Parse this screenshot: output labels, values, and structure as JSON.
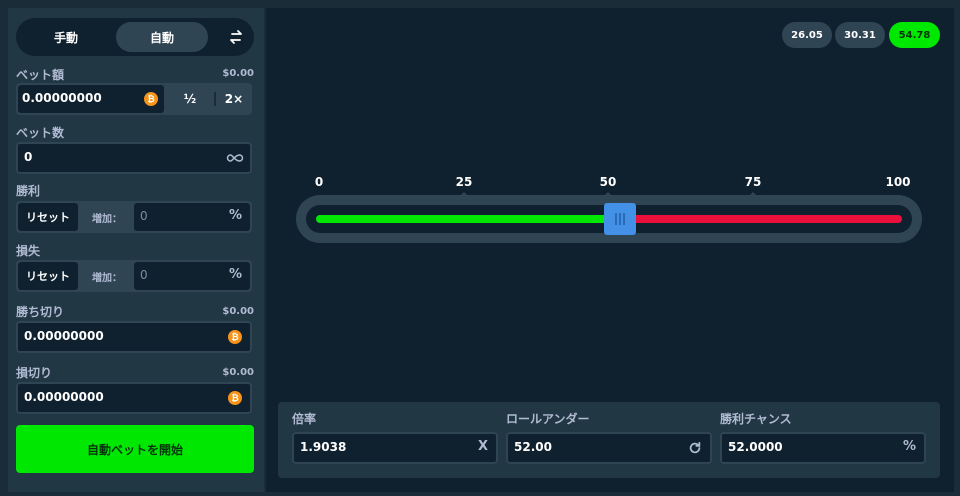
{
  "sidebar": {
    "mode_tabs": {
      "manual": "手動",
      "auto": "自動"
    },
    "bet_amount": {
      "label": "ベット額",
      "usd": "$0.00",
      "value": "0.00000000",
      "half": "½",
      "double": "2×"
    },
    "bet_count": {
      "label": "ベット数",
      "value": "0"
    },
    "on_win": {
      "label": "勝利",
      "reset": "リセット",
      "increase": "増加：",
      "value": "0",
      "pct": "%"
    },
    "on_loss": {
      "label": "損失",
      "reset": "リセット",
      "increase": "増加：",
      "value": "0",
      "pct": "%"
    },
    "stop_profit": {
      "label": "勝ち切り",
      "usd": "$0.00",
      "value": "0.00000000"
    },
    "stop_loss": {
      "label": "損切り",
      "usd": "$0.00",
      "value": "0.00000000"
    },
    "start_button": "自動ベットを開始"
  },
  "history": [
    "26.05",
    "30.31",
    "54.78"
  ],
  "slider": {
    "ticks": [
      "0",
      "25",
      "50",
      "75",
      "100"
    ],
    "value": 52
  },
  "controls": {
    "multiplier": {
      "label": "倍率",
      "value": "1.9038",
      "suffix": "X"
    },
    "roll_under": {
      "label": "ロールアンダー",
      "value": "52.00"
    },
    "win_chance": {
      "label": "勝利チャンス",
      "value": "52.0000",
      "suffix": "%"
    }
  },
  "colors": {
    "accent_green": "#00e701",
    "loss_red": "#e9113c",
    "handle_blue": "#4391e7",
    "coin_orange": "#f7931a"
  },
  "icons": {
    "swap": "swap-arrows-icon",
    "coin": "bitcoin-icon",
    "infinity": "infinity-icon",
    "refresh": "refresh-icon"
  }
}
